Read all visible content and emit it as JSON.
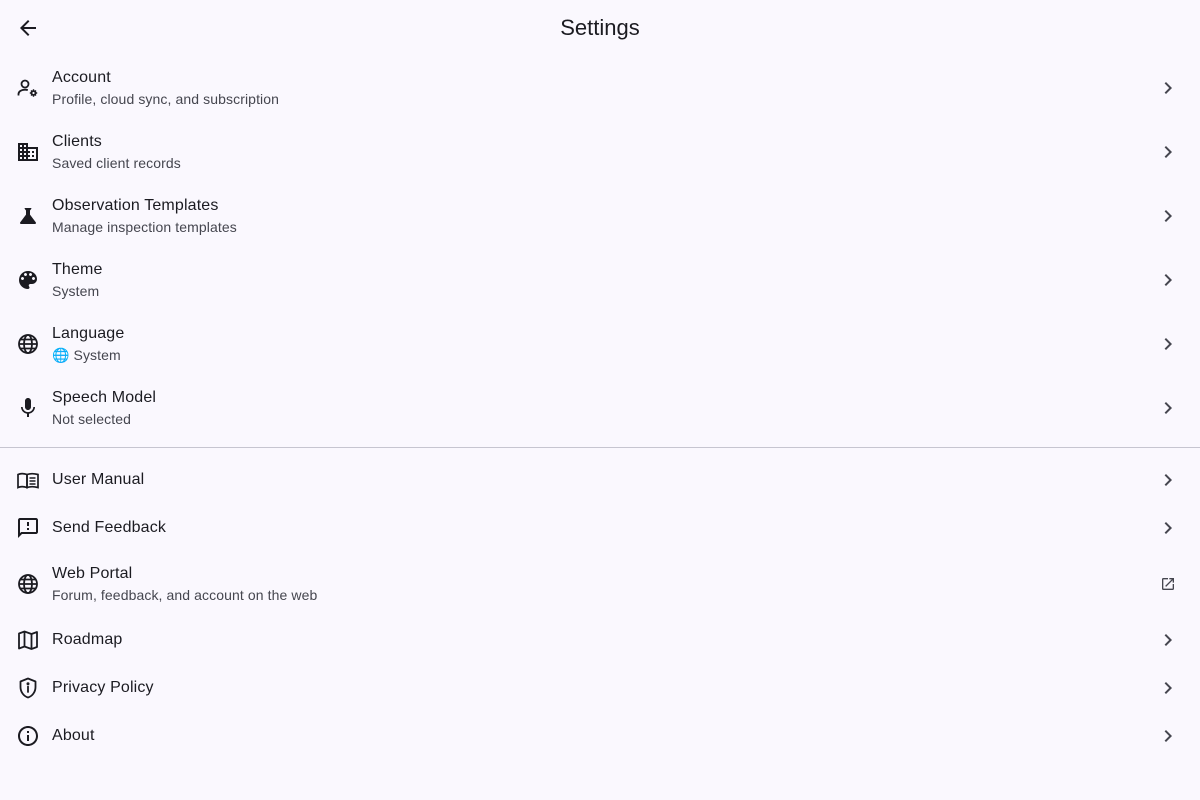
{
  "appbar": {
    "title": "Settings",
    "back_icon": "arrow-back-icon"
  },
  "section1": [
    {
      "title": "Account",
      "subtitle": "Profile, cloud sync, and subscription",
      "icon": "manage-accounts-icon"
    },
    {
      "title": "Clients",
      "subtitle": "Saved client records",
      "icon": "business-icon"
    },
    {
      "title": "Observation Templates",
      "subtitle": "Manage inspection templates",
      "icon": "science-icon"
    },
    {
      "title": "Theme",
      "subtitle": "System",
      "icon": "palette-icon"
    },
    {
      "title": "Language",
      "subtitle": "🌐 System",
      "icon": "globe-icon"
    },
    {
      "title": "Speech Model",
      "subtitle": "Not selected",
      "icon": "mic-icon"
    }
  ],
  "section2": [
    {
      "title": "User Manual",
      "icon": "menu-book-icon"
    },
    {
      "title": "Send Feedback",
      "icon": "feedback-icon"
    },
    {
      "title": "Web Portal",
      "subtitle": "Forum, feedback, and account on the web",
      "icon": "globe-icon",
      "trailing": "open-in-new-icon"
    },
    {
      "title": "Roadmap",
      "icon": "map-icon"
    },
    {
      "title": "Privacy Policy",
      "icon": "privacy-shield-icon"
    },
    {
      "title": "About",
      "icon": "info-icon"
    }
  ],
  "colors": {
    "background": "#faf8fe",
    "text": "#1b1b21",
    "subtext": "#45464f",
    "divider": "#c6c5d0"
  }
}
